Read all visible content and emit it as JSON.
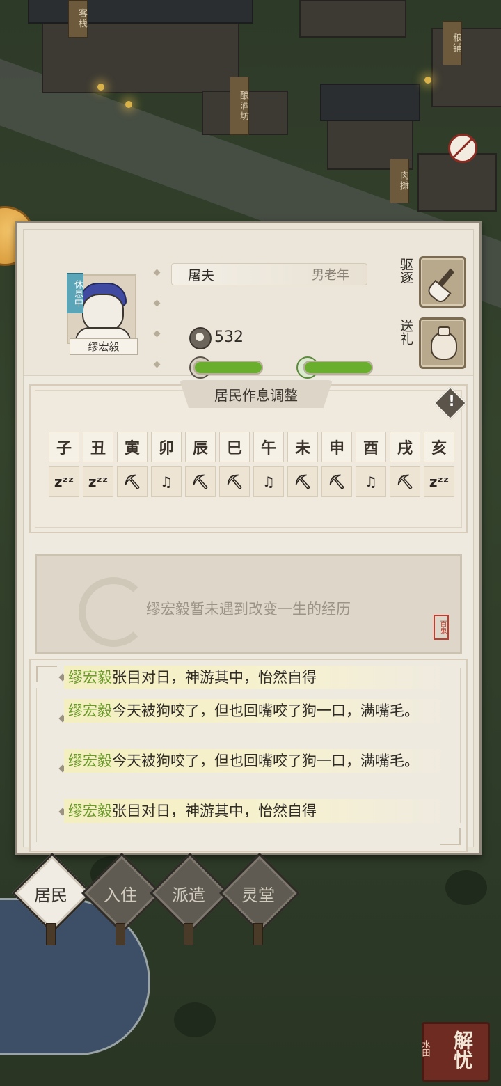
{
  "map": {
    "signs": [
      "客栈",
      "酿酒坊",
      "粮铺",
      "肉摊"
    ]
  },
  "resident": {
    "status": "休息中",
    "name": "缪宏毅",
    "job": "屠夫",
    "age_group": "男老年",
    "money": "532",
    "health_level": 1.0,
    "mood_level": 1.0
  },
  "actions": {
    "expel_label": "驱逐",
    "gift_label": "送礼"
  },
  "schedule": {
    "title": "居民作息调整",
    "hours": [
      "子",
      "丑",
      "寅",
      "卯",
      "辰",
      "巳",
      "午",
      "未",
      "申",
      "酉",
      "戌",
      "亥"
    ],
    "activities": [
      "sleep-icon",
      "sleep-icon",
      "work-icon",
      "leisure-icon",
      "work-icon",
      "work-icon",
      "leisure-icon",
      "work-icon",
      "work-icon",
      "leisure-icon",
      "work-icon",
      "sleep-icon"
    ]
  },
  "story": {
    "text": "缪宏毅暂未遇到改变一生的经历",
    "seal": "百鬼"
  },
  "log": [
    {
      "name": "缪宏毅",
      "text": "张目对日，神游其中，怡然自得"
    },
    {
      "name": "缪宏毅",
      "text": "今天被狗咬了，但也回嘴咬了狗一口，满嘴毛。"
    },
    {
      "name": "缪宏毅",
      "text": "今天被狗咬了，但也回嘴咬了狗一口，满嘴毛。"
    },
    {
      "name": "缪宏毅",
      "text": "张目对日，神游其中，怡然自得"
    }
  ],
  "tabs": [
    {
      "label": "居民",
      "active": true
    },
    {
      "label": "入住",
      "active": false
    },
    {
      "label": "派遣",
      "active": false
    },
    {
      "label": "灵堂",
      "active": false
    }
  ],
  "corner_button": {
    "label": "解忧",
    "sub": "水田"
  },
  "colors": {
    "bar_green": "#6aae2e",
    "name_green": "#6a9a2a",
    "status_tag": "#5aa6b8"
  }
}
